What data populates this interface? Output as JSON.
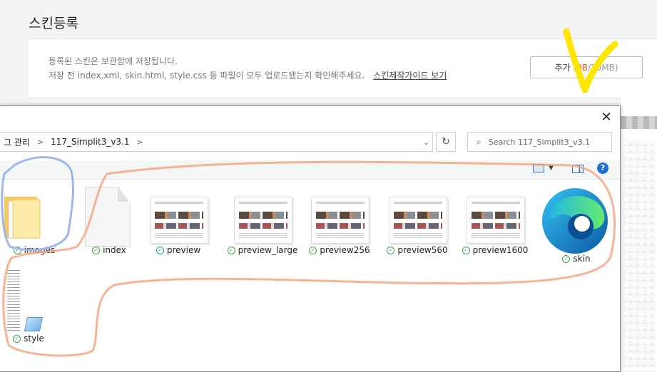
{
  "page": {
    "title": "스킨등록",
    "info_line1": "등록된 스킨은 보관함에 저장됩니다.",
    "info_line2": "저장 전 index.xml, skin.html, style.css 등 파일이 모두 업로드됐는지 확인해주세요.",
    "guide_link": "스킨제작가이드 보기",
    "add_button": {
      "label": "추가",
      "used": "0B",
      "separator": "/",
      "limit": "20MB",
      "open_paren": "(",
      "close_paren": ")"
    }
  },
  "dialog": {
    "close_icon": "close-icon",
    "breadcrumb": [
      "그 관리",
      "117_Simplit3_v3.1"
    ],
    "search_placeholder": "Search 117_Simplit3_v3.1",
    "toolbar": {
      "help_label": "?"
    },
    "files": [
      {
        "name": "images",
        "type": "folder",
        "status": "synced"
      },
      {
        "name": "index",
        "type": "document",
        "status": "synced"
      },
      {
        "name": "preview",
        "type": "image",
        "status": "synced"
      },
      {
        "name": "preview_large",
        "type": "image",
        "status": "synced"
      },
      {
        "name": "preview256",
        "type": "image",
        "status": "synced"
      },
      {
        "name": "preview560",
        "type": "image",
        "status": "synced"
      },
      {
        "name": "preview1600",
        "type": "image",
        "status": "synced"
      },
      {
        "name": "skin",
        "type": "edge-html",
        "status": "synced"
      },
      {
        "name": "style",
        "type": "css-text",
        "status": "synced"
      }
    ]
  },
  "colors": {
    "accent_used": "#f05a28",
    "sync_check": "#3aa34a",
    "help_blue": "#1f6fd0",
    "annotation_orange": "#f5a07a",
    "annotation_blue": "#9db8e8",
    "annotation_yellow": "#ffe600"
  }
}
